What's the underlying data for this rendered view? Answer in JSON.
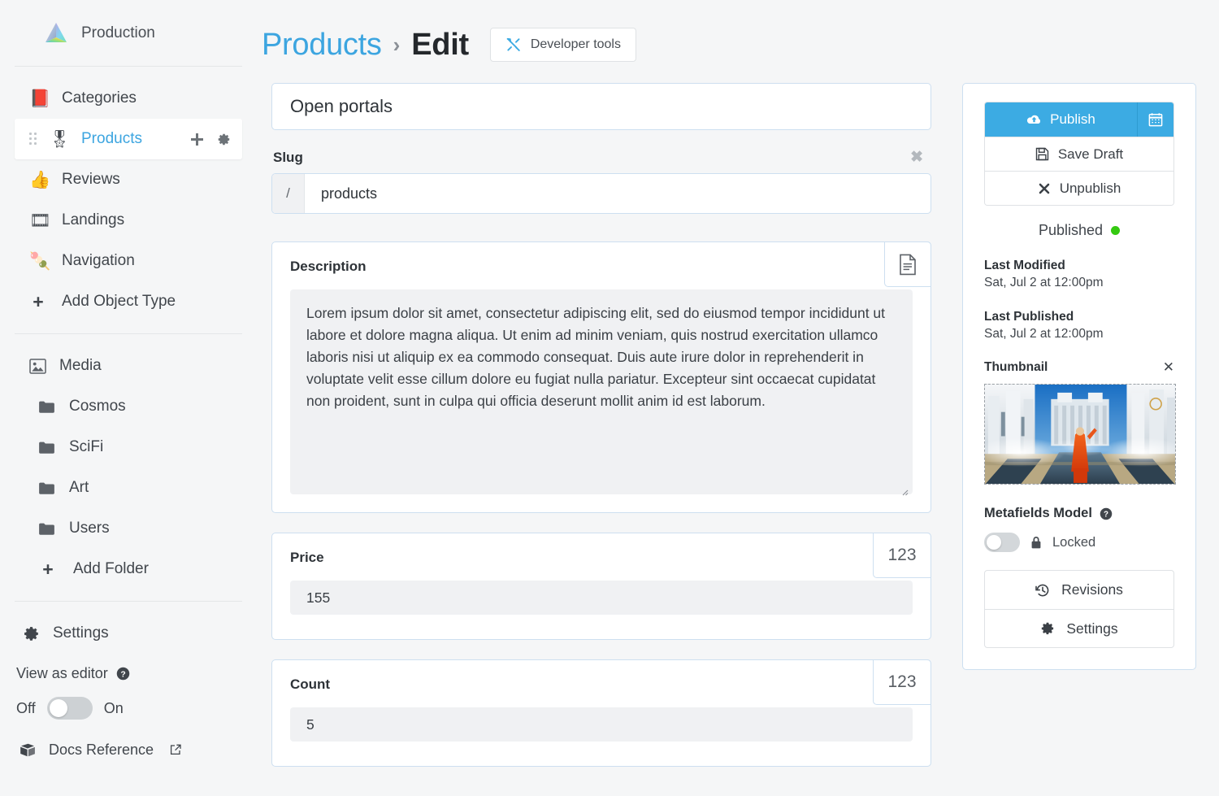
{
  "sidebar": {
    "brand": {
      "name": "Production",
      "logo_icon": "prism-logo"
    },
    "object_types": [
      {
        "label": "Categories",
        "emoji": "📕",
        "icon": "closed-book-emoji",
        "active": false
      },
      {
        "label": "Products",
        "emoji": "🎖️",
        "icon": "medal-emoji",
        "active": true
      },
      {
        "label": "Reviews",
        "emoji": "👍",
        "icon": "thumbs-up-emoji",
        "active": false
      },
      {
        "label": "Landings",
        "emoji": "🎞️",
        "icon": "film-frames-emoji",
        "active": false
      },
      {
        "label": "Navigation",
        "emoji": "🍡",
        "icon": "dango-emoji",
        "active": false
      }
    ],
    "add_object_type": "Add Object Type",
    "media_label": "Media",
    "folders": [
      "Cosmos",
      "SciFi",
      "Art",
      "Users"
    ],
    "add_folder": "Add Folder",
    "settings_label": "Settings",
    "view_as_editor": {
      "label": "View as editor",
      "off_label": "Off",
      "on_label": "On",
      "state": "off"
    },
    "docs_reference": "Docs Reference"
  },
  "header": {
    "breadcrumb_parent": "Products",
    "breadcrumb_separator": "›",
    "breadcrumb_current": "Edit",
    "developer_tools": "Developer tools"
  },
  "form": {
    "title_value": "Open portals",
    "slug": {
      "label": "Slug",
      "prefix": "/",
      "value": "products"
    },
    "description": {
      "label": "Description",
      "type_icon": "text-document-icon",
      "value": "Lorem ipsum dolor sit amet, consectetur adipiscing elit, sed do eiusmod tempor incididunt ut labore et dolore magna aliqua. Ut enim ad minim veniam, quis nostrud exercitation ullamco laboris nisi ut aliquip ex ea commodo consequat. Duis aute irure dolor in reprehenderit in voluptate velit esse cillum dolore eu fugiat nulla pariatur. Excepteur sint occaecat cupidatat non proident, sunt in culpa qui officia deserunt mollit anim id est laborum."
    },
    "price": {
      "label": "Price",
      "type_badge": "123",
      "value": "155"
    },
    "count": {
      "label": "Count",
      "type_badge": "123",
      "value": "5"
    }
  },
  "publish_panel": {
    "publish_label": "Publish",
    "publish_icon": "cloud-upload-icon",
    "schedule_icon": "calendar-icon",
    "save_draft_label": "Save Draft",
    "unpublish_label": "Unpublish",
    "status_label": "Published",
    "status_color": "#35c911",
    "last_modified_label": "Last Modified",
    "last_modified_value": "Sat, Jul 2 at 12:00pm",
    "last_published_label": "Last Published",
    "last_published_value": "Sat, Jul 2 at 12:00pm",
    "thumbnail_label": "Thumbnail",
    "thumbnail_remove_icon": "close-icon",
    "metafields_model_label": "Metafields Model",
    "metafields_locked_label": "Locked",
    "metafields_toggle_state": "off",
    "revisions_label": "Revisions",
    "settings_label": "Settings"
  },
  "colors": {
    "accent": "#3cabe3",
    "link": "#3ca5e0",
    "card_border": "#cddff0",
    "page_bg": "#f5f6f7",
    "status_green": "#35c911"
  }
}
